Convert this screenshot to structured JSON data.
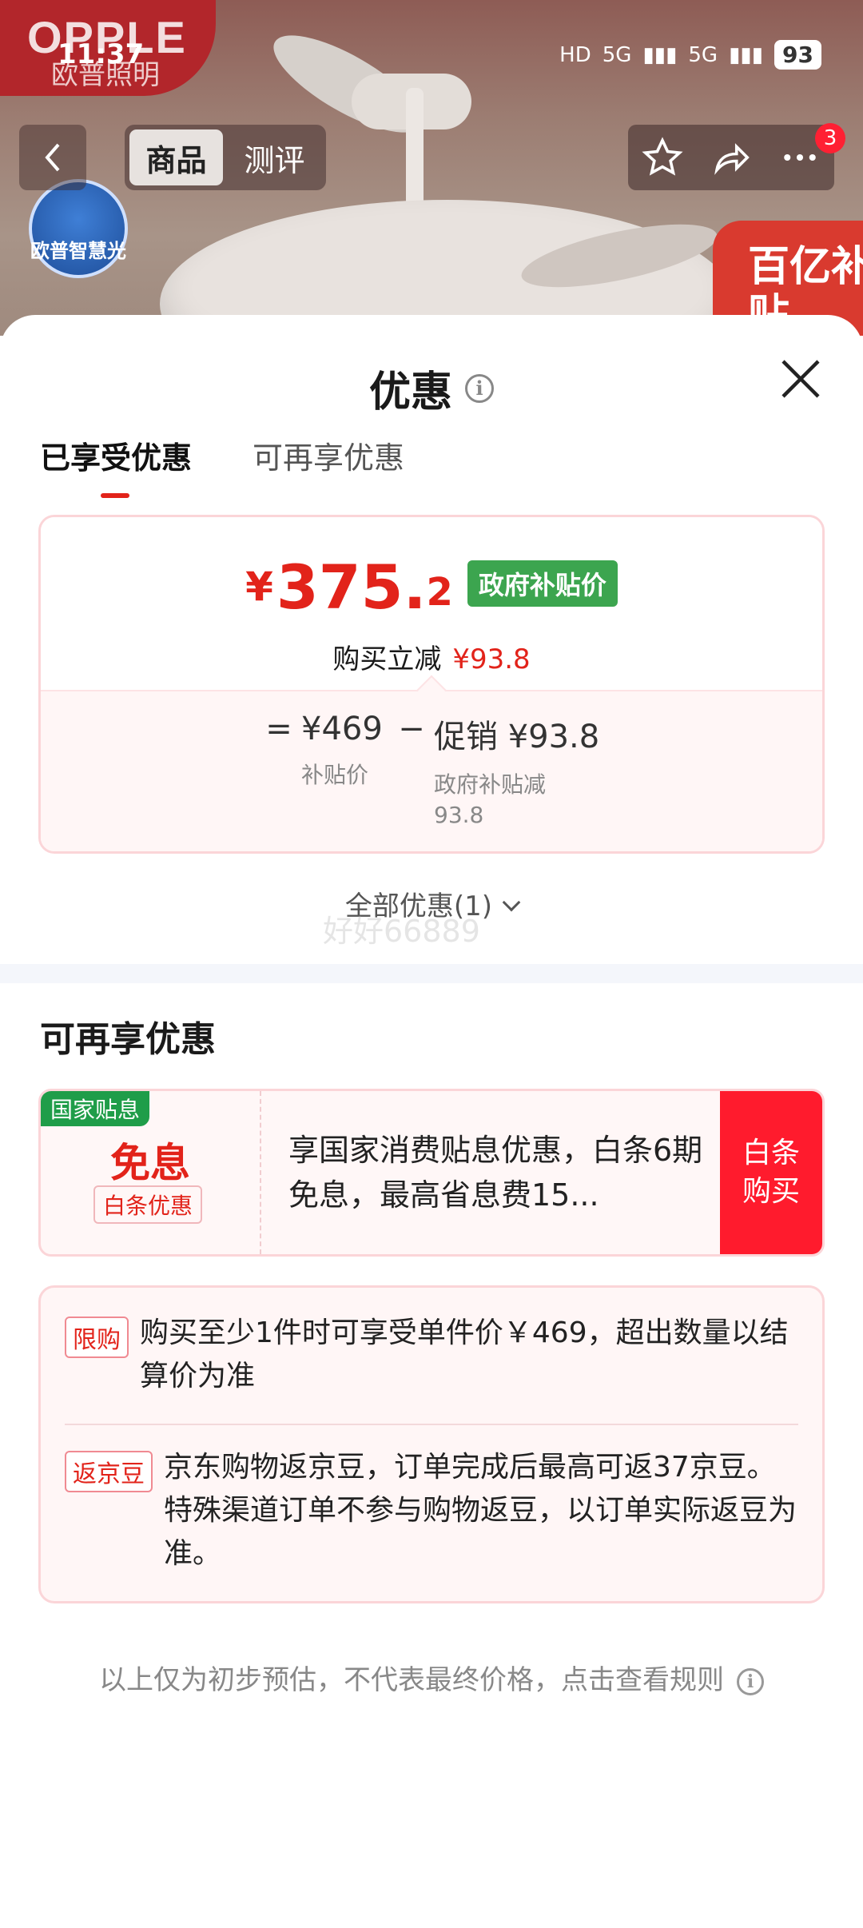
{
  "status_bar": {
    "time": "11:37",
    "network_hd": "HD",
    "network_5g_1": "5G",
    "network_5g_2": "5G",
    "battery": "93"
  },
  "product_bg": {
    "brand": "OPPLE",
    "brand_sub": "欧普照明",
    "logo_text": "欧普智慧光",
    "subsidy_badge": "百亿补贴"
  },
  "header": {
    "tab_product": "商品",
    "tab_review": "测评",
    "notification_count": "3"
  },
  "sheet": {
    "title": "优惠",
    "tabs": [
      "已享受优惠",
      "可再享优惠"
    ],
    "price_card": {
      "currency": "¥",
      "price_int": "375.",
      "price_dec": "2",
      "gov_tag": "政府补贴价",
      "reduce_label": "购买立减",
      "reduce_amount": "¥93.8",
      "eq": "=",
      "base_price": "¥469",
      "base_label": "补贴价",
      "minus": "−",
      "promo_value": "促销 ¥93.8",
      "promo_label": "政府补贴减\n93.8"
    },
    "all_offers": "全部优惠(1)",
    "watermark": "好好66889",
    "section_title": "可再享优惠",
    "coupon": {
      "flag": "国家贴息",
      "main": "免息",
      "sub": "白条优惠",
      "desc": "享国家消费贴息优惠，白条6期免息，最高省息费15...",
      "buy": "白条\n购买"
    },
    "info_rows": [
      {
        "tag": "限购",
        "text": "购买至少1件时可享受单件价￥469，超出数量以结算价为准"
      },
      {
        "tag": "返京豆",
        "text": "京东购物返京豆，订单完成后最高可返37京豆。特殊渠道订单不参与购物返豆，以订单实际返豆为准。"
      }
    ],
    "footer": "以上仅为初步预估，不代表最终价格，点击查看规则"
  },
  "colors": {
    "accent_red": "#e2231a",
    "gov_green": "#3ca54f",
    "buy_red": "#ff1b2d"
  }
}
